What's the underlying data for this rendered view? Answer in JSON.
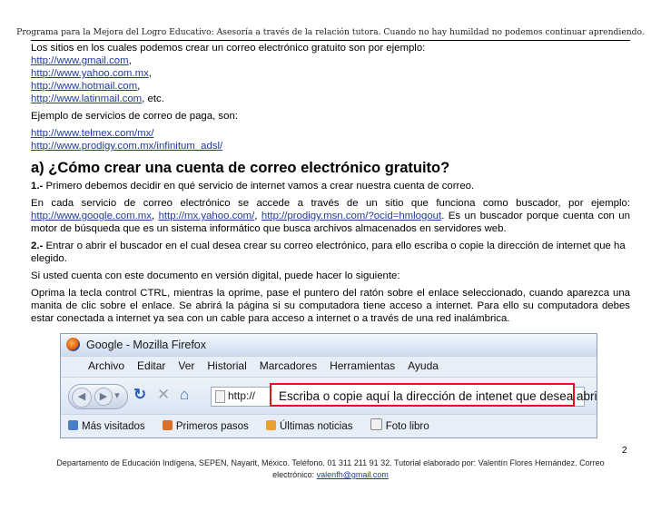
{
  "header": {
    "text": "Programa para la Mejora del Logro Educativo: Asesoría a través de la relación tutora. Cuando no hay humildad no podemos continuar aprendiendo."
  },
  "intro": "Los sitios en los cuales podemos crear un correo electrónico gratuito son por ejemplo:",
  "free_sites": [
    {
      "url": "http://www.gmail.com",
      "after": ","
    },
    {
      "url": "http://www.yahoo.com.mx",
      "after": ","
    },
    {
      "url": "http://www.hotmail.com",
      "after": ","
    },
    {
      "url": "http://www.latinmail.com",
      "after": ", etc."
    }
  ],
  "paid_intro": "Ejemplo de servicios de correo de paga, son:",
  "paid_sites": [
    "http://www.telmex.com/mx/",
    "http://www.prodigy.com.mx/infinitum_adsl/"
  ],
  "heading": "a) ¿Cómo crear una cuenta de correo electrónico gratuito?",
  "step1": {
    "num": "1.-",
    "text": " Primero debemos decidir en qué servicio de internet vamos a crear nuestra cuenta de correo."
  },
  "para1": {
    "before": "En cada servicio de correo electrónico se accede a través de un sitio que funciona como buscador, por ejemplo: ",
    "link1": "http://www.google.com.mx",
    "sep1": ", ",
    "link2": "http://mx.yahoo.com/",
    "sep2": ", ",
    "link3": "http://prodigy.msn.com/?ocid=hmlogout",
    "after": ". Es un buscador porque cuenta con un motor de búsqueda que es un sistema informático que busca archivos almacenados en servidores web."
  },
  "step2": {
    "num": "2.-",
    "text": " Entrar o abrir el buscador en el cual desea crear su correo electrónico, para ello escriba o copie la dirección de internet que ha elegido."
  },
  "para2": "Si usted cuenta con este documento en versión digital, puede hacer lo siguiente:",
  "para3": "Oprima la tecla control CTRL, mientras la oprime, pase el puntero del ratón sobre el enlace seleccionado, cuando aparezca una manita de clic sobre el enlace. Se abrirá la página si su computadora tiene acceso a internet. Para ello su computadora debes estar conectada a internet ya sea con un cable para acceso a internet o a través de una red inalámbrica.",
  "screenshot": {
    "window_title": "Google - Mozilla Firefox",
    "menu": [
      "Archivo",
      "Editar",
      "Ver",
      "Historial",
      "Marcadores",
      "Herramientas",
      "Ayuda"
    ],
    "url_text": "http://",
    "callout": "Escriba o copie aquí la dirección de intenet que desea abrir.",
    "bookmarks": [
      "Más visitados",
      "Primeros pasos",
      "Últimas noticias",
      "Foto libro"
    ]
  },
  "page_number": "2",
  "footer": {
    "line1": "Departamento de Educación Indígena, SEPEN, Nayarit, México.  Teléfono.  01 311 211 91 32. Tutorial elaborado por: Valentín Flores Hernández. Correo",
    "line2_prefix": "electrónico: ",
    "email": "valenfh@gmail.com"
  },
  "colors": {
    "link": "#1f3b9a",
    "callout_border": "#e0141e"
  }
}
